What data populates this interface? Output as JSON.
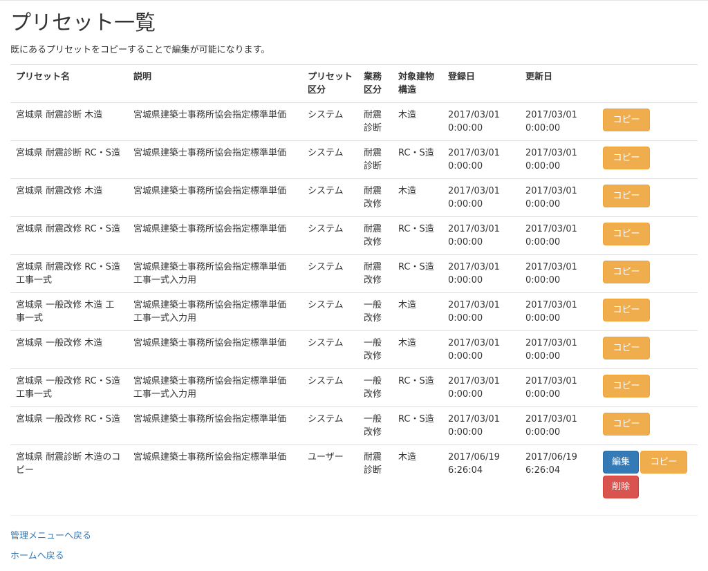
{
  "page": {
    "title": "プリセット一覧",
    "lead": "既にあるプリセットをコピーすることで編集が可能になります。"
  },
  "table": {
    "columns": [
      "プリセット名",
      "説明",
      "プリセット区分",
      "業務区分",
      "対象建物構造",
      "登録日",
      "更新日",
      ""
    ],
    "copy_label": "コピー",
    "edit_label": "編集",
    "delete_label": "削除",
    "rows": [
      {
        "name": "宮城県 耐震診断 木造",
        "desc": "宮城県建築士事務所協会指定標準単価",
        "preset_type": "システム",
        "work_type": "耐震診断",
        "structure": "木造",
        "registered": "2017/03/01 0:00:00",
        "updated": "2017/03/01 0:00:00",
        "actions": [
          "copy"
        ]
      },
      {
        "name": "宮城県 耐震診断 RC・S造",
        "desc": "宮城県建築士事務所協会指定標準単価",
        "preset_type": "システム",
        "work_type": "耐震診断",
        "structure": "RC・S造",
        "registered": "2017/03/01 0:00:00",
        "updated": "2017/03/01 0:00:00",
        "actions": [
          "copy"
        ]
      },
      {
        "name": "宮城県 耐震改修 木造",
        "desc": "宮城県建築士事務所協会指定標準単価",
        "preset_type": "システム",
        "work_type": "耐震改修",
        "structure": "木造",
        "registered": "2017/03/01 0:00:00",
        "updated": "2017/03/01 0:00:00",
        "actions": [
          "copy"
        ]
      },
      {
        "name": "宮城県 耐震改修 RC・S造",
        "desc": "宮城県建築士事務所協会指定標準単価",
        "preset_type": "システム",
        "work_type": "耐震改修",
        "structure": "RC・S造",
        "registered": "2017/03/01 0:00:00",
        "updated": "2017/03/01 0:00:00",
        "actions": [
          "copy"
        ]
      },
      {
        "name": "宮城県 耐震改修 RC・S造 工事一式",
        "desc": "宮城県建築士事務所協会指定標準単価 工事一式入力用",
        "preset_type": "システム",
        "work_type": "耐震改修",
        "structure": "RC・S造",
        "registered": "2017/03/01 0:00:00",
        "updated": "2017/03/01 0:00:00",
        "actions": [
          "copy"
        ]
      },
      {
        "name": "宮城県 一般改修 木造 工事一式",
        "desc": "宮城県建築士事務所協会指定標準単価 工事一式入力用",
        "preset_type": "システム",
        "work_type": "一般改修",
        "structure": "木造",
        "registered": "2017/03/01 0:00:00",
        "updated": "2017/03/01 0:00:00",
        "actions": [
          "copy"
        ]
      },
      {
        "name": "宮城県 一般改修 木造",
        "desc": "宮城県建築士事務所協会指定標準単価",
        "preset_type": "システム",
        "work_type": "一般改修",
        "structure": "木造",
        "registered": "2017/03/01 0:00:00",
        "updated": "2017/03/01 0:00:00",
        "actions": [
          "copy"
        ]
      },
      {
        "name": "宮城県 一般改修 RC・S造 工事一式",
        "desc": "宮城県建築士事務所協会指定標準単価 工事一式入力用",
        "preset_type": "システム",
        "work_type": "一般改修",
        "structure": "RC・S造",
        "registered": "2017/03/01 0:00:00",
        "updated": "2017/03/01 0:00:00",
        "actions": [
          "copy"
        ]
      },
      {
        "name": "宮城県 一般改修 RC・S造",
        "desc": "宮城県建築士事務所協会指定標準単価",
        "preset_type": "システム",
        "work_type": "一般改修",
        "structure": "RC・S造",
        "registered": "2017/03/01 0:00:00",
        "updated": "2017/03/01 0:00:00",
        "actions": [
          "copy"
        ]
      },
      {
        "name": "宮城県 耐震診断 木造のコピー",
        "desc": "宮城県建築士事務所協会指定標準単価",
        "preset_type": "ユーザー",
        "work_type": "耐震診断",
        "structure": "木造",
        "registered": "2017/06/19 6:26:04",
        "updated": "2017/06/19 6:26:04",
        "actions": [
          "edit",
          "copy",
          "delete"
        ]
      }
    ]
  },
  "footer": {
    "admin_menu_link": "管理メニューへ戻る",
    "home_link": "ホームへ戻る"
  },
  "colors": {
    "warning": "#f0ad4e",
    "primary": "#337ab7",
    "danger": "#d9534f",
    "link": "#337ab7"
  }
}
